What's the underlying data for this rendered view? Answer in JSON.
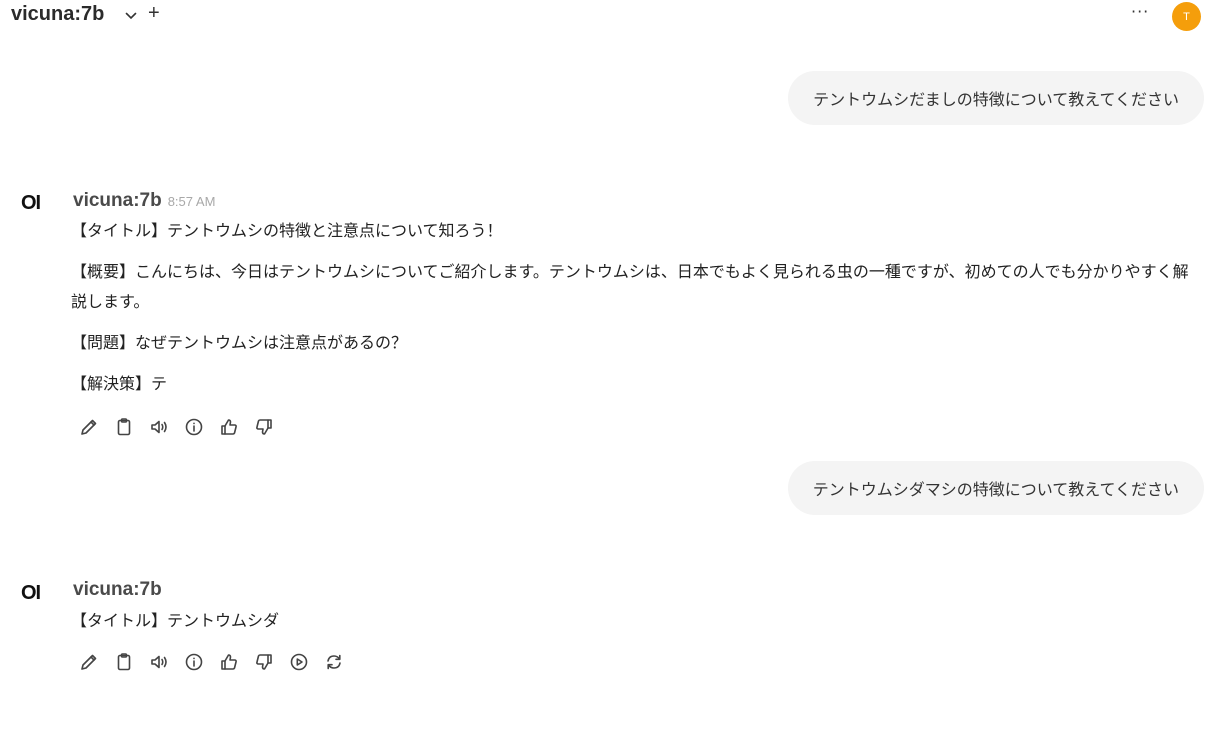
{
  "header": {
    "model_name": "vicuna:7b",
    "avatar_initial": "T",
    "avatar_color": "#f59e0b",
    "icons": [
      "chevron-down-icon",
      "plus-icon",
      "more-horizontal-icon"
    ]
  },
  "messages": {
    "user1": {
      "text": "テントウムシだましの特徴について教えてください"
    },
    "assistant1": {
      "name": "vicuna:7b",
      "time": "8:57 AM",
      "paragraphs": [
        "【タイトル】テントウムシの特徴と注意点について知ろう！",
        "【概要】こんにちは、今日はテントウムシについてご紹介します。テントウムシは、日本でもよく見られる虫の一種ですが、初めての人でも分かりやすく解説します。",
        "【問題】なぜテントウムシは注意点があるの？",
        "【解決策】テ"
      ],
      "actions": [
        "edit-icon",
        "copy-icon",
        "read-aloud-icon",
        "info-icon",
        "thumbs-up-icon",
        "thumbs-down-icon"
      ]
    },
    "user2": {
      "text": "テントウムシダマシの特徴について教えてください"
    },
    "assistant2": {
      "name": "vicuna:7b",
      "paragraphs": [
        "【タイトル】テントウムシダ"
      ],
      "actions": [
        "edit-icon",
        "copy-icon",
        "read-aloud-icon",
        "info-icon",
        "thumbs-up-icon",
        "thumbs-down-icon",
        "continue-icon",
        "regenerate-icon"
      ]
    }
  }
}
